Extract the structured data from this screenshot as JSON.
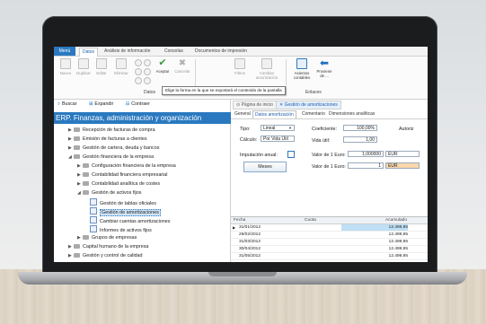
{
  "tabs": {
    "menu": "Menú",
    "items": [
      "Datos",
      "Análisis de información",
      "Consolas",
      "Documentos de impresión"
    ]
  },
  "ribbon": {
    "buttons": [
      {
        "label": "Nuevo",
        "icon": "new-doc-icon"
      },
      {
        "label": "Duplicar",
        "icon": "duplicate-icon"
      },
      {
        "label": "Editar",
        "icon": "edit-icon"
      },
      {
        "label": "Eliminar",
        "icon": "delete-icon"
      },
      {
        "label": "Aceptar",
        "icon": "check-icon"
      },
      {
        "label": "Cancelar",
        "icon": "cancel-icon"
      },
      {
        "label": "Filtros",
        "icon": "filter-icon"
      },
      {
        "label": "Cambiar amortización",
        "icon": "change-amortization-icon"
      },
      {
        "label": "Asientos contables",
        "icon": "accounting-entries-icon"
      },
      {
        "label": "Proviene de ...",
        "icon": "back-arrow-icon"
      }
    ],
    "group_datos": "Datos",
    "group_enlaces": "Enlaces",
    "tooltip": "Elige la forma en la que se exportará el contenido de la pantalla"
  },
  "left": {
    "toolbar": {
      "search": "Buscar",
      "expand": "Expandir",
      "collapse": "Contraer"
    },
    "title": "ERP. Finanzas, administración y organización",
    "tree": [
      {
        "label": "Recepción de facturas de compra"
      },
      {
        "label": "Emisión de facturas a clientes"
      },
      {
        "label": "Gestión de cartera, deuda y bancos"
      },
      {
        "label": "Gestión financiera de la empresa"
      },
      {
        "label": "Configuración financiera de la empresa"
      },
      {
        "label": "Contabilidad financiera empresarial"
      },
      {
        "label": "Contabilidad analítica de costes"
      },
      {
        "label": "Gestión de activos fijos"
      },
      {
        "label": "Gestión de tablas oficiales"
      },
      {
        "label": "Gestión de amortizaciones"
      },
      {
        "label": "Cambiar cuentas amortizaciones"
      },
      {
        "label": "Informes de activos fijos"
      },
      {
        "label": "Grupos de empresas"
      },
      {
        "label": "Capital humano de la empresa"
      },
      {
        "label": "Gestión y control de calidad"
      }
    ]
  },
  "right": {
    "tabs": [
      "Página de inicio",
      "Gestión de amortizaciones"
    ],
    "subtabs": [
      "General",
      "Datos amortización",
      "Comentario",
      "Dimensiones analíticas"
    ],
    "form": {
      "tipo_label": "Tipo:",
      "tipo_value": "Lineal",
      "calculo_label": "Cálculo:",
      "calculo_value": "Por Vida Útil",
      "imputacion_label": "Imputación anual:",
      "meses_button": "Meses",
      "coef_label": "Coeficiente:",
      "coef_value": "100,00%",
      "vida_label": "Vida útil:",
      "vida_value": "1,00",
      "valor1_label": "Valor de 1 Euro:",
      "valor1_value": "1,000000",
      "valor1_currency": "EUR",
      "valor2_label": "Valor de 1 Euro:",
      "valor2_value": "1",
      "valor2_currency": "EUR",
      "autorizar_label": "Autoriz"
    },
    "grid": {
      "headers": [
        "Fecha",
        "Cuota",
        "Acumulado"
      ],
      "rows": [
        {
          "date": "31/01/2012",
          "value": "12.499,95"
        },
        {
          "date": "29/02/2012",
          "value": "12.499,95"
        },
        {
          "date": "31/03/2012",
          "value": "12.499,95"
        },
        {
          "date": "30/04/2012",
          "value": "12.499,95"
        },
        {
          "date": "31/05/2012",
          "value": "12.499,95"
        }
      ]
    }
  }
}
